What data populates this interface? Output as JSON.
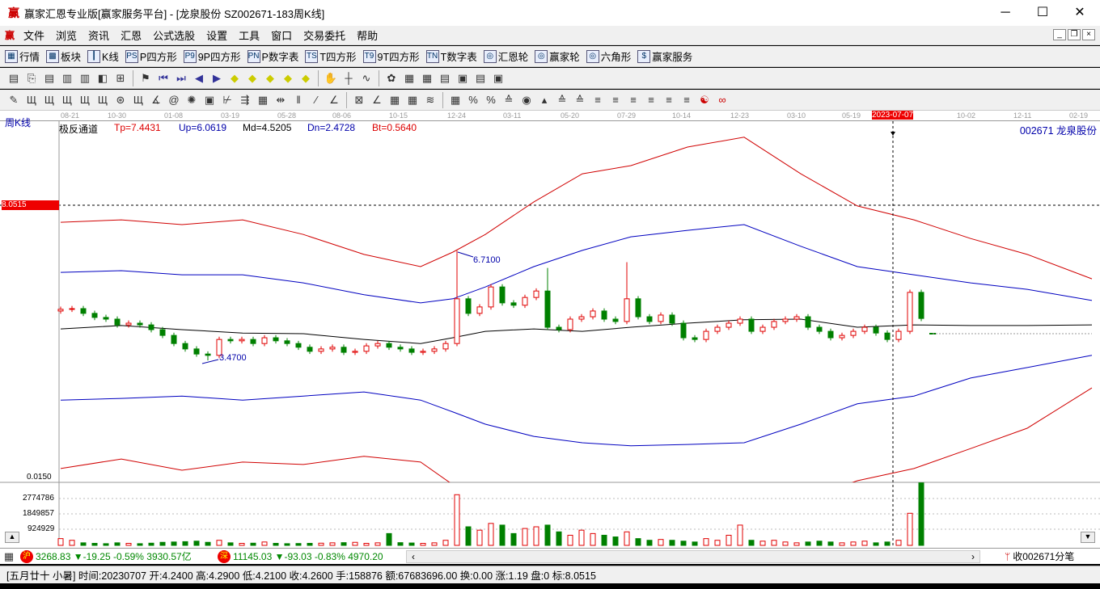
{
  "window": {
    "title": "赢家汇恩专业版[赢家服务平台] - [龙泉股份  SZ002671-183周K线]",
    "logo": "赢",
    "min": "─",
    "max": "☐",
    "close": "✕"
  },
  "menu": [
    "文件",
    "浏览",
    "资讯",
    "汇恩",
    "公式选股",
    "设置",
    "工具",
    "窗口",
    "交易委托",
    "帮助"
  ],
  "toolbar1": [
    {
      "label": "行情",
      "icon": "grid-icon",
      "g": "▦"
    },
    {
      "label": "板块",
      "icon": "blocks-icon",
      "g": "▩"
    },
    {
      "label": "K线",
      "icon": "kline-icon",
      "g": "┃"
    },
    {
      "label": "P四方形",
      "icon": "ps-icon",
      "g": "PS"
    },
    {
      "label": "9P四方形",
      "icon": "p9-icon",
      "g": "P9"
    },
    {
      "label": "P数字表",
      "icon": "pn-icon",
      "g": "PN"
    },
    {
      "label": "T四方形",
      "icon": "ts-icon",
      "g": "TS"
    },
    {
      "label": "9T四方形",
      "icon": "t9-icon",
      "g": "T9"
    },
    {
      "label": "T数字表",
      "icon": "tn-icon",
      "g": "TN"
    },
    {
      "label": "汇恩轮",
      "icon": "wheel-icon",
      "g": "◎"
    },
    {
      "label": "赢家轮",
      "icon": "wheel2-icon",
      "g": "◎"
    },
    {
      "label": "六角形",
      "icon": "hexagon-icon",
      "g": "◎"
    },
    {
      "label": "赢家服务",
      "icon": "dollar-icon",
      "g": "$"
    }
  ],
  "toolbar2_icons": [
    "book-icon",
    "copy-icon",
    "doc-icon",
    "chart-small-icon",
    "chart-small2-icon",
    "candle-icon",
    "cross-chart-icon",
    "flag-icon",
    "first-icon",
    "last-icon",
    "left-icon",
    "right-icon",
    "diamond-up-icon",
    "diamond-down-icon",
    "diamond-left-icon",
    "diamond-right-icon",
    "diamond-icon",
    "hand-icon",
    "crosshair-icon",
    "line-icon",
    "gift-icon",
    "calendar-icon",
    "calculator-icon",
    "news-icon",
    "save-icon",
    "print-icon",
    "bus-icon"
  ],
  "toolbar3_icons": [
    "pencil-icon",
    "bars1-icon",
    "bars2-icon",
    "bars3-icon",
    "bars4-icon",
    "bars5-icon",
    "circle-grid-icon",
    "bars6-icon",
    "fan-icon",
    "spiral-icon",
    "star-icon",
    "box-icon",
    "fork-icon",
    "arrows-icon",
    "grid2-icon",
    "cross-arrow-icon",
    "channel-icon",
    "fan2-icon",
    "pitch-icon",
    "box-x-icon",
    "angle-icon",
    "grid3-icon",
    "grid4-icon",
    "parallel-icon",
    "table-icon",
    "percent-swash-icon",
    "percent-icon",
    "gann1-icon",
    "gann2-icon",
    "gann3-icon",
    "arrow-flag-icon",
    "gann4-icon",
    "gann5-icon",
    "gann6-icon",
    "gann7-icon",
    "gann8-icon",
    "gann9-icon",
    "gann10-icon",
    "yinyang-icon",
    "infinity-icon"
  ],
  "dates": [
    "08-21",
    "10-30",
    "01-08",
    "03-19",
    "05-28",
    "08-06",
    "10-15",
    "12-24",
    "03-11",
    "05-20",
    "07-29",
    "10-14",
    "12-23",
    "03-10",
    "05-19",
    "2023-07-07",
    "10-02",
    "12-11",
    "02-19"
  ],
  "chart_info": {
    "period": "周K线",
    "indicator": "极反通道",
    "tp": "Tp=7.4431",
    "up": "Up=6.0619",
    "md": "Md=4.5205",
    "dn": "Dn=2.4728",
    "bt": "Bt=0.5640",
    "stock": "002671  龙泉股份"
  },
  "axis": {
    "price_marker": "8.0515",
    "price_low": "0.0150",
    "vol_labels": [
      "2774786",
      "1849857",
      "924929"
    ]
  },
  "annotations": {
    "high": "6.7100",
    "low": "3.4700"
  },
  "colors": {
    "up": "#e00000",
    "down": "#008000",
    "tp": "#d00000",
    "up_line": "#0000c0",
    "md": "#000000",
    "dn": "#0000c0",
    "bt": "#d00000"
  },
  "chart_data": {
    "type": "candlestick",
    "title": "龙泉股份 002671 周K线 极反通道",
    "ylim": [
      0.015,
      8.0515
    ],
    "channel": {
      "tp": [
        7.55,
        7.62,
        7.48,
        7.62,
        7.19,
        6.6,
        6.24,
        6.67,
        7.19,
        8.15,
        8.98,
        9.22,
        9.77,
        10.06,
        8.98,
        8.03,
        7.62,
        7.07,
        6.6,
        5.88
      ],
      "up": [
        6.07,
        6.12,
        6.0,
        6.0,
        5.76,
        5.41,
        5.17,
        5.29,
        5.64,
        6.24,
        6.72,
        7.12,
        7.31,
        7.48,
        6.84,
        6.24,
        6.0,
        5.76,
        5.57,
        5.24
      ],
      "md": [
        4.4,
        4.5,
        4.38,
        4.28,
        4.26,
        4.09,
        3.97,
        4.14,
        4.33,
        4.4,
        4.33,
        4.45,
        4.57,
        4.67,
        4.69,
        4.45,
        4.52,
        4.5,
        4.5,
        4.52
      ],
      "dn": [
        2.3,
        2.35,
        2.42,
        2.3,
        2.42,
        2.54,
        2.3,
        1.95,
        1.59,
        1.23,
        1.04,
        0.95,
        0.99,
        1.04,
        1.59,
        2.19,
        2.42,
        2.95,
        3.26,
        3.62
      ],
      "bt": [
        0.28,
        0.56,
        0.23,
        0.47,
        0.4,
        0.64,
        0.47,
        -0.2,
        -0.68,
        -1.15,
        -1.39,
        -1.63,
        -1.39,
        -1.15,
        -0.68,
        -0.08,
        0.28,
        0.87,
        1.47,
        2.66
      ]
    },
    "close": [
      4.98,
      5.0,
      4.86,
      4.74,
      4.69,
      4.52,
      4.57,
      4.52,
      4.38,
      4.21,
      3.97,
      3.81,
      3.66,
      3.62,
      4.09,
      4.05,
      4.09,
      3.97,
      4.14,
      4.05,
      3.97,
      3.86,
      3.74,
      3.81,
      3.86,
      3.71,
      3.74,
      3.9,
      3.97,
      3.86,
      3.81,
      3.71,
      3.74,
      3.81,
      3.97,
      5.29,
      4.86,
      5.05,
      5.64,
      5.17,
      5.1,
      5.33,
      5.52,
      4.45,
      4.38,
      4.69,
      4.76,
      4.93,
      4.69,
      4.62,
      5.29,
      4.76,
      4.62,
      4.81,
      4.57,
      4.14,
      4.09,
      4.33,
      4.45,
      4.57,
      4.69,
      4.33,
      4.45,
      4.62,
      4.69,
      4.76,
      4.45,
      4.33,
      4.14,
      4.21,
      4.33,
      4.45,
      4.28,
      4.09,
      4.33,
      5.48,
      4.71
    ],
    "volume": [
      400,
      300,
      150,
      120,
      100,
      150,
      120,
      100,
      130,
      180,
      200,
      220,
      250,
      180,
      300,
      150,
      120,
      130,
      200,
      120,
      100,
      110,
      120,
      130,
      150,
      160,
      180,
      120,
      150,
      700,
      160,
      140,
      120,
      150,
      300,
      3000,
      1100,
      900,
      1300,
      1200,
      700,
      1000,
      1100,
      1200,
      800,
      600,
      900,
      700,
      600,
      500,
      800,
      400,
      300,
      350,
      300,
      250,
      200,
      400,
      300,
      600,
      1200,
      300,
      250,
      300,
      200,
      150,
      200,
      250,
      200,
      150,
      200,
      250,
      150,
      200,
      300,
      1900,
      3700
    ],
    "last": {
      "date": "20230707",
      "open": 4.24,
      "high": 4.29,
      "low": 4.21,
      "close": 4.26
    }
  },
  "ticker": {
    "sh_icon": "沪",
    "sh": "3268.83 ▼-19.25 -0.59% 3930.57亿",
    "sz_icon": "深",
    "sz": "11145.03 ▼-93.03 -0.83% 4970.20",
    "right": "收002671分笔"
  },
  "status": "[五月廿十 小暑] 时间:20230707 开:4.2400 高:4.2900 低:4.2100 收:4.2600 手:158876 额:67683696.00 换:0.00 涨:1.19 盘:0 标:8.0515"
}
